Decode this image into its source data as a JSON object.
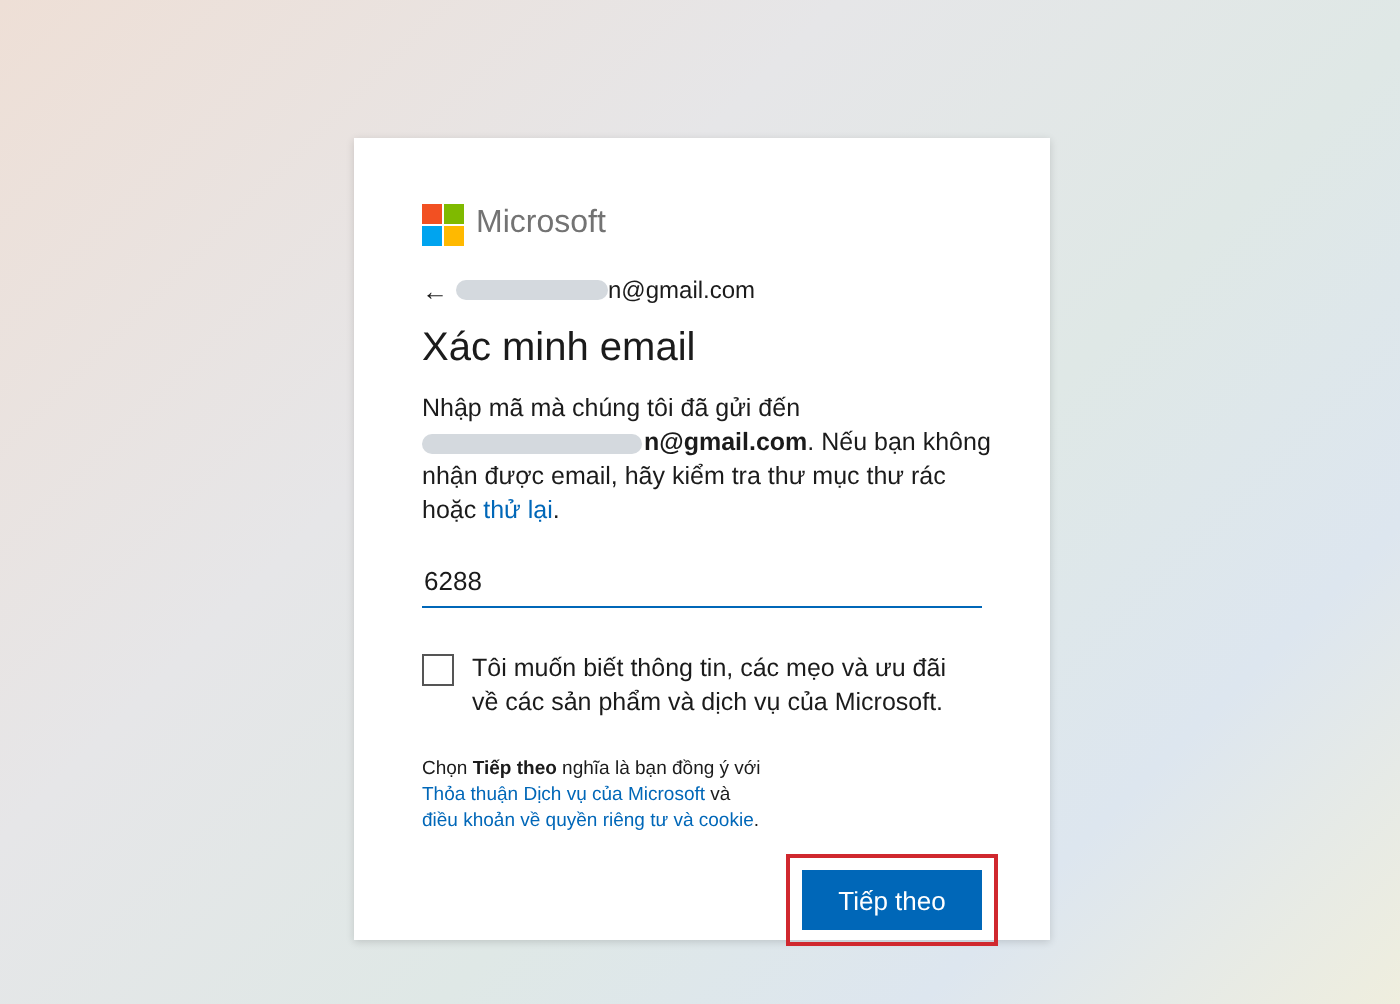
{
  "brand": "Microsoft",
  "identity": {
    "back": "←",
    "email": "n@gmail.com"
  },
  "title": "Xác minh email",
  "description": {
    "lead": "Nhập mã mà chúng tôi đã gửi đến",
    "rest": "**n@gmail.com**. Nếu bạn không nhận được email, hãy kiểm tra thư mục thư rác hoặc",
    "link": "thử lại",
    "end": "."
  },
  "code_field": {
    "value": "6288"
  },
  "offers_checkbox": {
    "label": "Tôi muốn biết thông tin, các mẹo và ưu đãi về các sản phẩm và dịch vụ của Microsoft.",
    "checked": false
  },
  "legal": {
    "parts": [
      {
        "kind": "text",
        "text": "Chọn **Tiếp theo** nghĩa là bạn đồng ý với "
      },
      {
        "kind": "link",
        "text": "Thỏa thuận Dịch vụ của Microsoft"
      },
      {
        "kind": "text",
        "text": " và "
      },
      {
        "kind": "link",
        "text": "điều khoản về quyền riêng tư và cookie"
      },
      {
        "kind": "text",
        "text": "."
      }
    ]
  },
  "next_button": {
    "label": "Tiếp theo",
    "highlighted": true
  }
}
